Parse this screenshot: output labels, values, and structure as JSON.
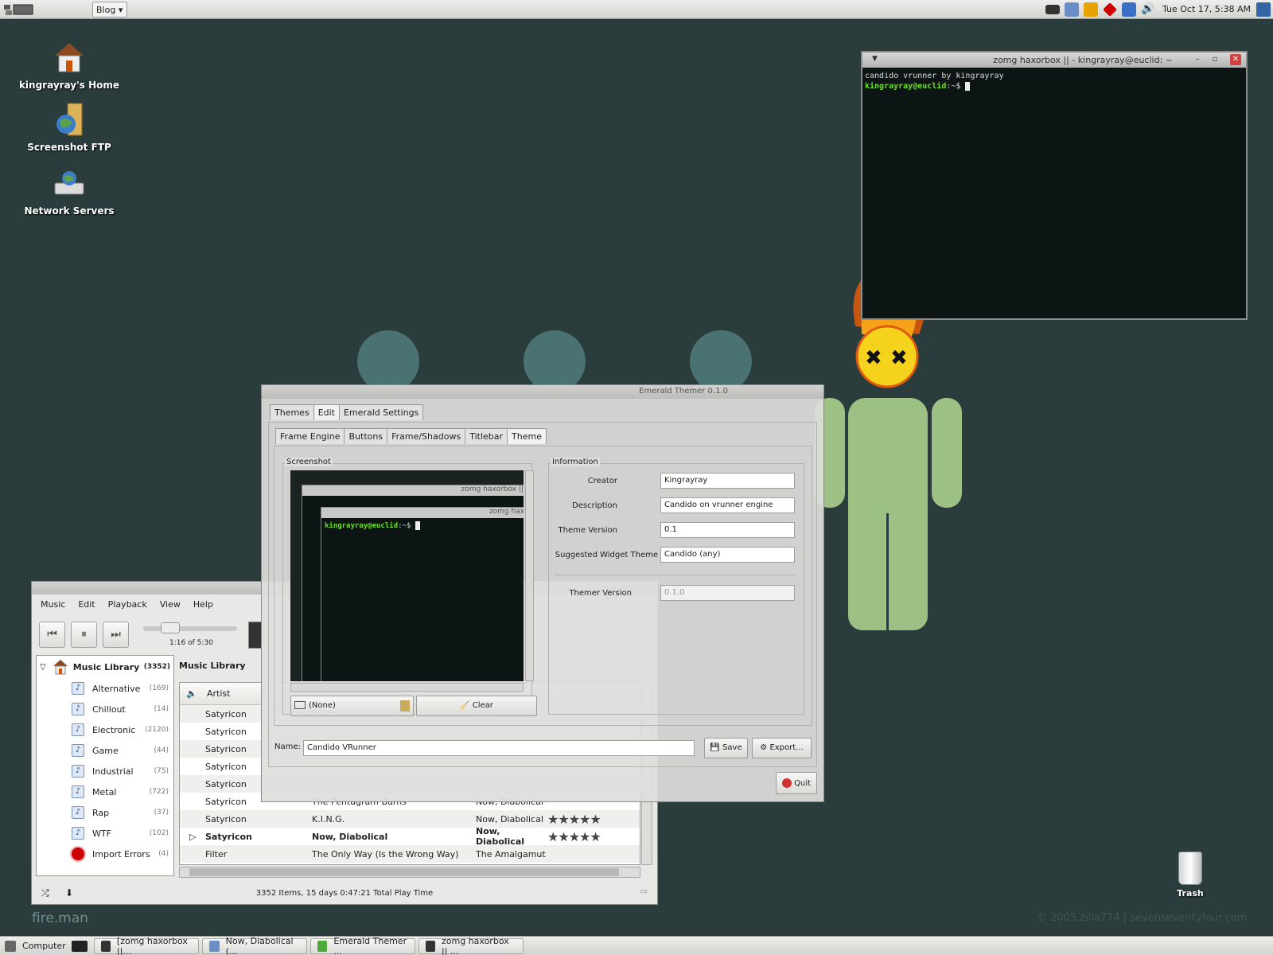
{
  "top_panel": {
    "menu_button": "Blog",
    "clock": "Tue Oct 17,  5:38 AM"
  },
  "desktop_icons": [
    {
      "label": "kingrayray's Home",
      "icon": "home-icon"
    },
    {
      "label": "Screenshot FTP",
      "icon": "ftp-folder-icon"
    },
    {
      "label": "Network Servers",
      "icon": "network-servers-icon"
    }
  ],
  "trash": {
    "label": "Trash"
  },
  "watermarks": {
    "left": "fire.man",
    "right": "© 2005.zilla774 | sevenseventyfour.com"
  },
  "terminal": {
    "title": "zomg haxorbox || - kingrayray@euclid: ~",
    "line1": "candido vrunner by kingrayray",
    "prompt": "kingrayray@euclid",
    "prompt_suffix": ":~$"
  },
  "music": {
    "menu": [
      "Music",
      "Edit",
      "Playback",
      "View",
      "Help"
    ],
    "time": "1:16 of 5:30",
    "seek_fraction": 0.23,
    "library_label": "Music Library",
    "library_count": "(3352)",
    "main_heading": "Music Library",
    "playlists": [
      {
        "label": "Alternative",
        "count": "(169)"
      },
      {
        "label": "Chillout",
        "count": "(14)"
      },
      {
        "label": "Electronic",
        "count": "(2120)"
      },
      {
        "label": "Game",
        "count": "(44)"
      },
      {
        "label": "Industrial",
        "count": "(75)"
      },
      {
        "label": "Metal",
        "count": "(722)"
      },
      {
        "label": "Rap",
        "count": "(37)"
      },
      {
        "label": "WTF",
        "count": "(102)"
      }
    ],
    "import_errors": {
      "label": "Import Errors",
      "count": "(4)"
    },
    "column_artist": "Artist",
    "rows": [
      {
        "artist": "Satyricon",
        "title": "",
        "album": "",
        "rating": ""
      },
      {
        "artist": "Satyricon",
        "title": "",
        "album": "",
        "rating": ""
      },
      {
        "artist": "Satyricon",
        "title": "",
        "album": "",
        "rating": ""
      },
      {
        "artist": "Satyricon",
        "title": "",
        "album": "",
        "rating": ""
      },
      {
        "artist": "Satyricon",
        "title": "",
        "album": "",
        "rating": ""
      },
      {
        "artist": "Satyricon",
        "title": "The Pentagram Burns",
        "album": "Now, Diabolical",
        "rating": ""
      },
      {
        "artist": "Satyricon",
        "title": "K.I.N.G.",
        "album": "Now, Diabolical",
        "rating": "★★★★★"
      },
      {
        "artist": "Satyricon",
        "title": "Now, Diabolical",
        "album": "Now, Diabolical",
        "rating": "★★★★★"
      },
      {
        "artist": "Filter",
        "title": "The Only Way (Is the Wrong Way)",
        "album": "The Amalgamut",
        "rating": ""
      }
    ],
    "status": "3352 Items, 15 days 0:47:21 Total Play Time"
  },
  "emerald": {
    "title": "Emerald Themer 0.1.0",
    "tabs": [
      "Themes",
      "Edit",
      "Emerald Settings"
    ],
    "subtabs": [
      "Frame Engine",
      "Buttons",
      "Frame/Shadows",
      "Titlebar",
      "Theme"
    ],
    "screenshot_legend": "Screenshot",
    "information_legend": "Information",
    "mini_title1": "zomg haxorbox || - ",
    "mini_title2": "zomg haxor",
    "mini_prompt": "kingrayray@euclid",
    "mini_prompt_suffix": ":~$",
    "image_select": "(None)",
    "clear_button": "Clear",
    "fields": [
      {
        "label": "Creator",
        "value": "Kingrayray"
      },
      {
        "label": "Description",
        "value": "Candido on vrunner engine"
      },
      {
        "label": "Theme Version",
        "value": "0.1"
      },
      {
        "label": "Suggested Widget Theme",
        "value": "Candido (any)"
      }
    ],
    "themer_version_label": "Themer Version",
    "themer_version_value": "0.1.0",
    "name_label": "Name:",
    "name_value": "Candido VRunner",
    "save_button": "Save",
    "export_button": "Export...",
    "quit_button": "Quit"
  },
  "taskbar": {
    "computer": "Computer",
    "tasks": [
      {
        "label": "[zomg haxorbox ||..."
      },
      {
        "label": "Now, Diabolical (..."
      },
      {
        "label": "Emerald Themer ..."
      },
      {
        "label": "zomg haxorbox || ..."
      }
    ]
  },
  "colors": {
    "desktop": "#2a3c3c",
    "prompt": "#6fe02b",
    "fire": "#f5c518"
  }
}
